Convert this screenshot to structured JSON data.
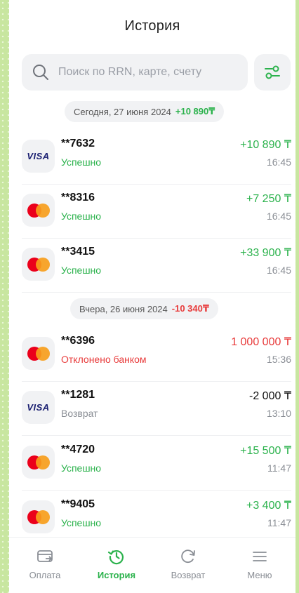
{
  "header": {
    "title": "История"
  },
  "search": {
    "placeholder": "Поиск по RRN, карте, счету"
  },
  "colors": {
    "accent": "#2bb24c",
    "negative": "#e83b3b",
    "visa": "#1a1f71",
    "mastercard_red": "#eb001b",
    "mastercard_orange": "#f79e1b"
  },
  "groups": [
    {
      "date": "Сегодня, 27 июня 2024",
      "total": "+10 890₸",
      "total_color": "green",
      "rows": [
        {
          "brand": "visa",
          "brand_label": "VISA",
          "card": "**7632",
          "status": "Успешно",
          "status_color": "green",
          "amount": "+10 890 ₸",
          "amount_color": "green",
          "time": "16:45"
        },
        {
          "brand": "mastercard",
          "card": "**8316",
          "status": "Успешно",
          "status_color": "green",
          "amount": "+7 250 ₸",
          "amount_color": "green",
          "time": "16:45"
        },
        {
          "brand": "mastercard",
          "card": "**3415",
          "status": "Успешно",
          "status_color": "green",
          "amount": "+33 900 ₸",
          "amount_color": "green",
          "time": "16:45"
        }
      ]
    },
    {
      "date": "Вчера, 26 июня 2024",
      "total": "-10 340₸",
      "total_color": "red",
      "rows": [
        {
          "brand": "mastercard",
          "card": "**6396",
          "status": "Отклонено банком",
          "status_color": "red",
          "amount": "1 000 000 ₸",
          "amount_color": "red",
          "time": "15:36"
        },
        {
          "brand": "visa",
          "brand_label": "VISA",
          "card": "**1281",
          "status": "Возврат",
          "status_color": "grey",
          "amount": "-2 000 ₸",
          "amount_color": "dark",
          "time": "13:10"
        },
        {
          "brand": "mastercard",
          "card": "**4720",
          "status": "Успешно",
          "status_color": "green",
          "amount": "+15 500 ₸",
          "amount_color": "green",
          "time": "11:47"
        },
        {
          "brand": "mastercard",
          "card": "**9405",
          "status": "Успешно",
          "status_color": "green",
          "amount": "+3 400 ₸",
          "amount_color": "green",
          "time": "11:47"
        }
      ]
    }
  ],
  "nav": [
    {
      "label": "Оплата",
      "icon": "payment-icon",
      "active": false
    },
    {
      "label": "История",
      "icon": "history-icon",
      "active": true
    },
    {
      "label": "Возврат",
      "icon": "refund-icon",
      "active": false
    },
    {
      "label": "Меню",
      "icon": "menu-icon",
      "active": false
    }
  ]
}
